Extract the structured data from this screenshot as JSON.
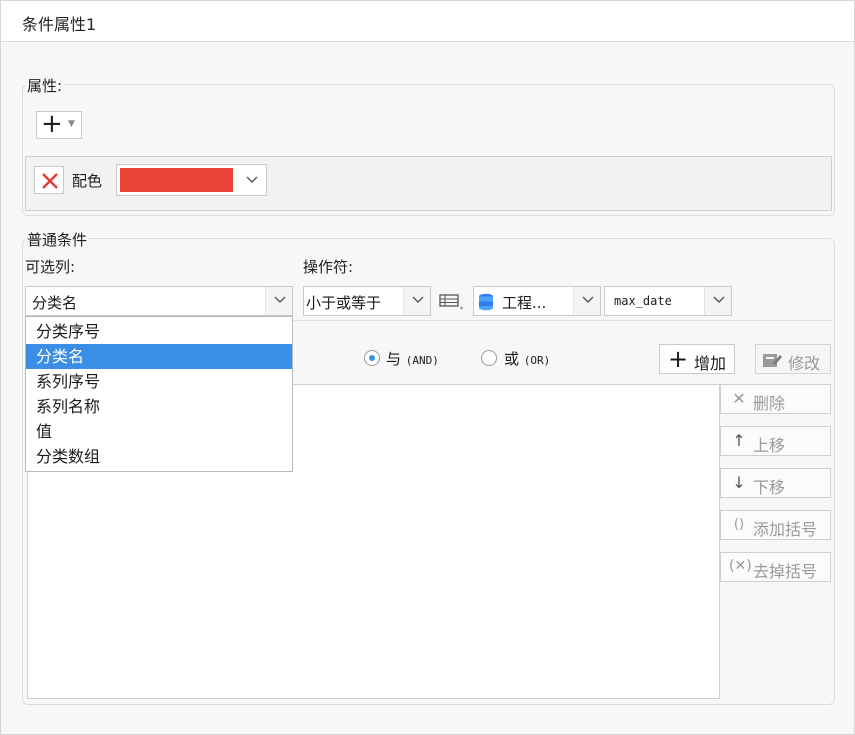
{
  "window": {
    "title": "条件属性1"
  },
  "attributes": {
    "group_label": "属性:",
    "add_button": {
      "icon": "plus-icon"
    },
    "row": {
      "remove_icon": "close-icon",
      "label": "配色",
      "color": "#ea4335"
    }
  },
  "condition": {
    "group_label": "普通条件",
    "column_label": "可选列:",
    "operator_label": "操作符:",
    "column_select": {
      "value": "分类名"
    },
    "operator_select": {
      "value": "小于或等于"
    },
    "dataset_select": {
      "value": "工程...",
      "icon": "database-icon"
    },
    "field_select": {
      "value": "max_date"
    },
    "dropdown": {
      "items": [
        "分类序号",
        "分类名",
        "系列序号",
        "系列名称",
        "值",
        "分类数组"
      ],
      "selected_index": 1
    },
    "logic": {
      "and_label": "与",
      "and_tag": "(AND)",
      "or_label": "或",
      "or_tag": "(OR)",
      "selected": "and"
    },
    "buttons": {
      "add": "增加",
      "modify": "修改",
      "delete": "删除",
      "move_up": "上移",
      "move_down": "下移",
      "add_bracket": "添加括号",
      "remove_bracket": "去掉括号"
    }
  },
  "colors": {
    "accent": "#3b8ee6",
    "swatch": "#ea4335"
  }
}
